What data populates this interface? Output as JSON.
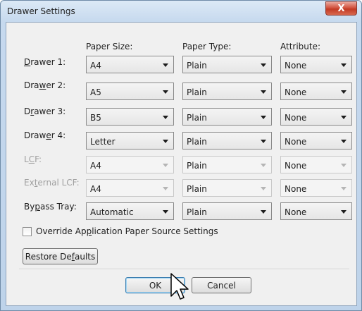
{
  "window": {
    "title": "Drawer Settings",
    "close_glyph": "X"
  },
  "columns": {
    "paper_size": "Paper Size:",
    "paper_type": "Paper Type:",
    "attribute": "Attribute:"
  },
  "rows": [
    {
      "label_pre": "",
      "label_key": "D",
      "label_post": "rawer 1:",
      "enabled": true,
      "paper_size": "A4",
      "paper_type": "Plain",
      "attribute": "None"
    },
    {
      "label_pre": "Dra",
      "label_key": "w",
      "label_post": "er 2:",
      "enabled": true,
      "paper_size": "A5",
      "paper_type": "Plain",
      "attribute": "None"
    },
    {
      "label_pre": "D",
      "label_key": "r",
      "label_post": "awer 3:",
      "enabled": true,
      "paper_size": "B5",
      "paper_type": "Plain",
      "attribute": "None"
    },
    {
      "label_pre": "Draw",
      "label_key": "e",
      "label_post": "r 4:",
      "enabled": true,
      "paper_size": "Letter",
      "paper_type": "Plain",
      "attribute": "None"
    },
    {
      "label_pre": "L",
      "label_key": "C",
      "label_post": "F:",
      "enabled": false,
      "paper_size": "A4",
      "paper_type": "Plain",
      "attribute": "None"
    },
    {
      "label_pre": "Ex",
      "label_key": "t",
      "label_post": "ernal LCF:",
      "enabled": false,
      "paper_size": "A4",
      "paper_type": "Plain",
      "attribute": "None"
    },
    {
      "label_pre": "By",
      "label_key": "p",
      "label_post": "ass Tray:",
      "enabled": true,
      "paper_size": "Automatic",
      "paper_type": "Plain",
      "attribute": "None"
    }
  ],
  "override_checkbox": {
    "label_pre": "Override Ap",
    "label_key": "p",
    "label_post": "lication Paper Source Settings",
    "checked": false
  },
  "restore_defaults": {
    "label_pre": "Restore De",
    "label_key": "f",
    "label_post": "aults"
  },
  "buttons": {
    "ok": "OK",
    "cancel": "Cancel"
  },
  "icons": {
    "combo_arrow": "chevron-down-icon",
    "close": "close-icon",
    "cursor": "mouse-pointer-icon"
  }
}
